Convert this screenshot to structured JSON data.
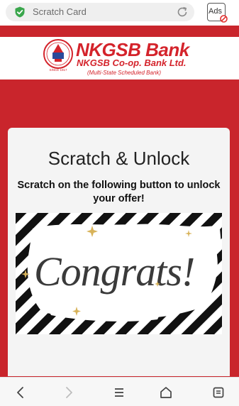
{
  "browser": {
    "url_text": "Scratch Card",
    "ads_label": "Ads",
    "icons": {
      "secure": "shield-check-icon",
      "reload": "reload-icon",
      "ads": "ad-block-icon"
    }
  },
  "bank": {
    "name": "NKGSB Bank",
    "subtitle": "NKGSB Co-op. Bank Ltd.",
    "tagline": "(Multi-State Scheduled Bank)",
    "seal_text": "SINCE 1917"
  },
  "card": {
    "title": "Scratch & Unlock",
    "subtitle": "Scratch on the following button to unlock your offer!",
    "scratch_text": "Congrats!"
  },
  "nav": {
    "icons": [
      "back-icon",
      "forward-icon",
      "menu-icon",
      "home-icon",
      "tabs-icon"
    ]
  },
  "colors": {
    "brand_red": "#d4232b",
    "page_red": "#c9252c",
    "secure_green": "#3aa64c"
  }
}
